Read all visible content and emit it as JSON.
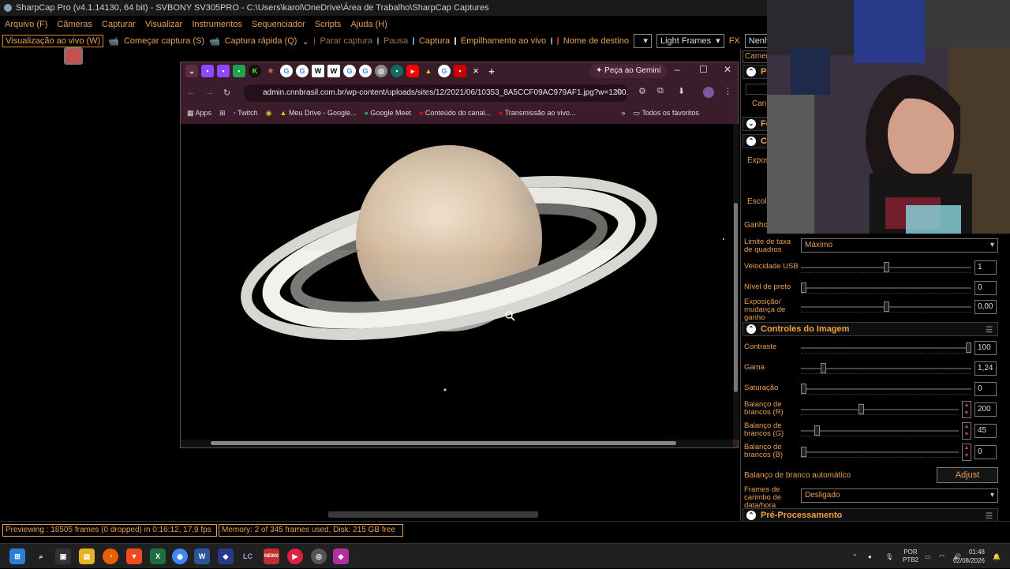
{
  "window": {
    "title": "SharpCap Pro (v4.1.14130, 64 bit) - SVBONY SV305PRO - C:\\Users\\karol\\OneDrive\\Área de Trabalho\\SharpCap Captures"
  },
  "menu": [
    "Arquivo (F)",
    "Câmeras",
    "Capturar",
    "Visualizar",
    "Instrumentos",
    "Sequenciador",
    "Scripts",
    "Ajuda (H)"
  ],
  "toolbar": {
    "live_view": "Visualização ao vivo (W)",
    "start_capture": "Começar captura (S)",
    "quick_capture": "Captura rápida (Q)",
    "stop_capture": "Parar captura",
    "pause": "Pausa",
    "capture": "Captura",
    "live_stack": "Empilhamento ao vivo",
    "target_name": "Nome de destino",
    "target_value": "",
    "frame_type": "Light Frames",
    "fx": "FX",
    "fx_value": "Nenh"
  },
  "chrome": {
    "gemini": "Peça ao Gemini",
    "url": "admin.cnnbrasil.com.br/wp-content/uploads/sites/12/2021/06/10353_8A5CCF09AC979AF1.jpg?w=1200...",
    "bookmarks": [
      "Apps",
      "Twitch",
      "Meu Drive - Google...",
      "Google Meet",
      "Conteúdo do canal...",
      "Transmissão ao vivo..."
    ],
    "all_bookmarks": "Todos os favoritos"
  },
  "panel": {
    "camera_tab": "Camer",
    "sec1": "Pe",
    "sec2": "Fo",
    "sec3": "Co",
    "expos": "Expos",
    "escol": "Escol",
    "cam_btn": "Can",
    "ganho": "Ganho",
    "frame_limit": {
      "label": "Limite de taxa de quadros",
      "value": "Máximo"
    },
    "usb": {
      "label": "Velocidade USB",
      "value": "1",
      "pos": 0.5
    },
    "black": {
      "label": "Nível de preto",
      "value": "0",
      "pos": 0
    },
    "exp_gain": {
      "label": "Exposição/ mudança de ganho",
      "value": "0,00",
      "pos": 0.5
    },
    "image_controls": "Controles do Imagem",
    "contrast": {
      "label": "Contraste",
      "value": "100",
      "pos": 1.0
    },
    "gamma": {
      "label": "Gama",
      "value": "1,24",
      "pos": 0.12
    },
    "saturation": {
      "label": "Saturação",
      "value": "0",
      "pos": 0
    },
    "wb_r": {
      "label": "Balanço de brancos (R)",
      "value": "200",
      "pos": 0.38
    },
    "wb_g": {
      "label": "Balanço de brancos (G)",
      "value": "45",
      "pos": 0.09
    },
    "wb_b": {
      "label": "Balanço de brancos (B)",
      "value": "0",
      "pos": 0
    },
    "auto_wb": {
      "label": "Balanço de branco automático",
      "button": "Adjust"
    },
    "timestamp": {
      "label": "Frames de carimbo de data/hora",
      "value": "Desligado"
    },
    "preproc": "Pré-Processamento"
  },
  "status": {
    "preview": "Previewing : 18505 frames (0 dropped) in 0:16:12, 17,9 fps",
    "memory": "Memory: 2 of 345 frames used, Disk: 215 GB free"
  },
  "taskbar": {
    "lang": "POR",
    "layout": "PTB2",
    "time": "01:48",
    "date": "02/08/2026",
    "lc": "LC",
    "tab_red": "NEWS"
  },
  "colors": {
    "accent": "#e7a055",
    "chrome_bg": "#3a1c2a",
    "panel_border": "#3a3a3a"
  }
}
